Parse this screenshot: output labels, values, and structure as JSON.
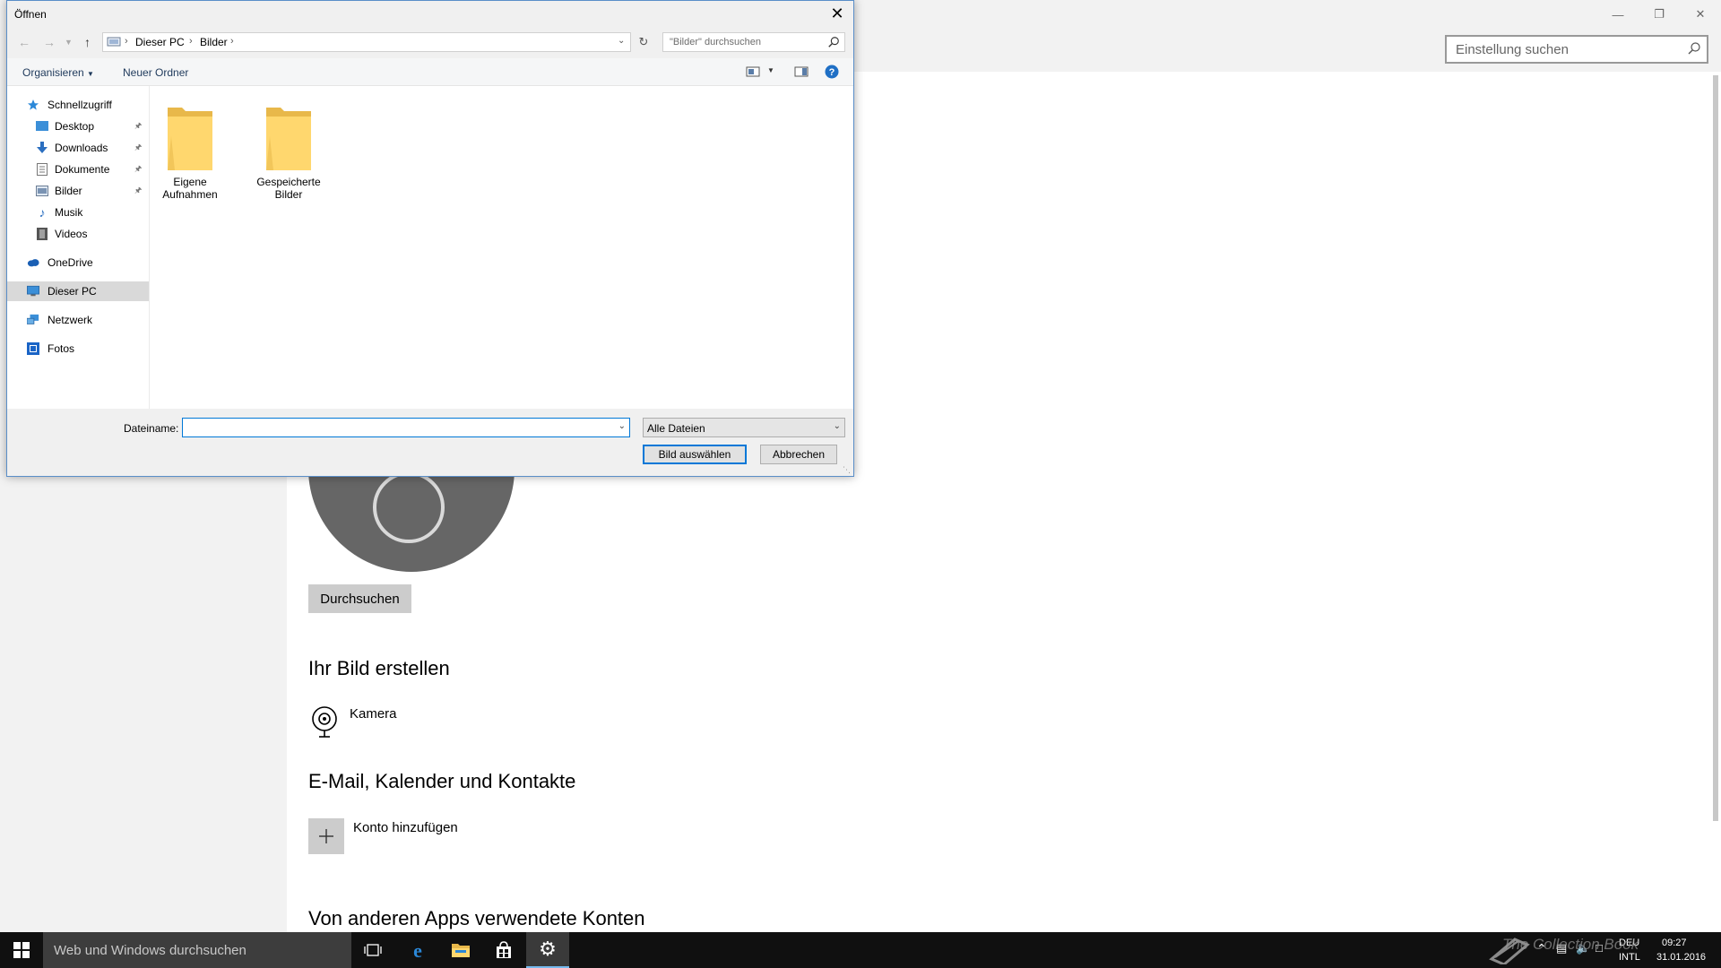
{
  "settings": {
    "search_placeholder": "Einstellung suchen",
    "browse_button": "Durchsuchen",
    "section_create": "Ihr Bild erstellen",
    "camera_label": "Kamera",
    "section_email": "E-Mail, Kalender und Kontakte",
    "add_account_label": "Konto hinzufügen",
    "section_other": "Von anderen Apps verwendete Konten"
  },
  "dialog": {
    "title": "Öffnen",
    "breadcrumb": [
      "Dieser PC",
      "Bilder"
    ],
    "search_placeholder": "\"Bilder\" durchsuchen",
    "organize": "Organisieren",
    "new_folder": "Neuer Ordner",
    "nav": {
      "quick_access": "Schnellzugriff",
      "desktop": "Desktop",
      "downloads": "Downloads",
      "documents": "Dokumente",
      "pictures": "Bilder",
      "music": "Musik",
      "videos": "Videos",
      "onedrive": "OneDrive",
      "this_pc": "Dieser PC",
      "network": "Netzwerk",
      "photos": "Fotos"
    },
    "folders": [
      {
        "line1": "Eigene",
        "line2": "Aufnahmen"
      },
      {
        "line1": "Gespeicherte",
        "line2": "Bilder"
      }
    ],
    "filename_label": "Dateiname:",
    "filename_value": "",
    "filetype": "Alle Dateien",
    "ok_button": "Bild auswählen",
    "cancel_button": "Abbrechen"
  },
  "taskbar": {
    "search_placeholder": "Web und Windows durchsuchen",
    "lang1": "DEU",
    "lang2": "INTL",
    "time": "09:27",
    "date": "31.01.2016",
    "watermark": "The Collection Book"
  },
  "colors": {
    "accent": "#0078d7",
    "folder": "#ffd76e",
    "taskbar": "#101010"
  }
}
